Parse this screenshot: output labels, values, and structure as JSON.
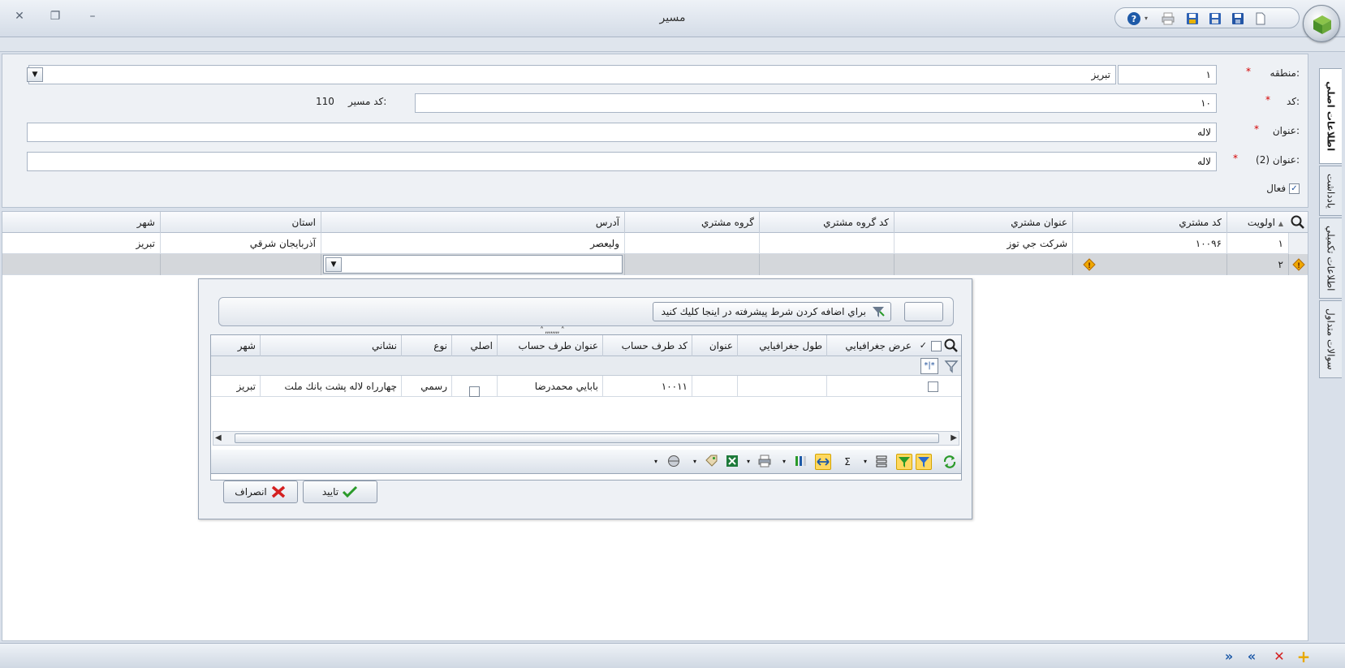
{
  "window": {
    "title": "مسير",
    "close_glyph": "✕",
    "restore_glyph": "❐",
    "minimize_glyph": "–"
  },
  "form": {
    "region_label": "منطقه:",
    "region_code": "١",
    "region_name": "تبريز",
    "code_label": "كد:",
    "code_value": "١٠",
    "route_code_label": "كد مسير:",
    "route_code_value": "110",
    "title_label": "عنوان:",
    "title_value": "لاله",
    "title2_label": "عنوان (2):",
    "title2_value": "لاله",
    "active_label": "فعال",
    "active_checked": "✓",
    "required_mark": "*"
  },
  "side_tabs": [
    {
      "label": "اطلاعات اصلي"
    },
    {
      "label": "يادداشت"
    },
    {
      "label": "اطلاعات تكميلي"
    },
    {
      "label": "سوالات متداول"
    }
  ],
  "grid": {
    "columns": [
      "اولويت",
      "كد مشتري",
      "عنوان مشتري",
      "كد گروه مشتري",
      "گروه مشتري",
      "آدرس",
      "استان",
      "شهر"
    ],
    "sort_indicator": "▲",
    "rows": [
      {
        "priority": "١",
        "customer_code": "١٠٠٩۶",
        "customer_title": "شركت جي توز",
        "group_code": "",
        "group": "",
        "address": "وليعصر",
        "province": "آذربايجان شرقي",
        "city": "تبريز"
      },
      {
        "priority": "٢",
        "customer_code": "",
        "customer_title": "",
        "group_code": "",
        "group": "",
        "address": "",
        "province": "",
        "city": ""
      }
    ]
  },
  "popup": {
    "filter_button": "براي اضافه كردن شرط پيشرفته در اينجا كليك كنيد",
    "drag_hint": "˄ ,,,,,,,, ˄",
    "columns": [
      "عرض جغرافيايي",
      "طول جغرافيايي",
      "عنوان",
      "كد طرف حساب",
      "عنوان طرف حساب",
      "اصلي",
      "نوع",
      "نشاني",
      "شهر"
    ],
    "check_header": "✓",
    "rows": [
      {
        "lat": "",
        "lng": "",
        "title": "",
        "account_code": "١٠٠١١",
        "account_title": "بابايي محمدرضا",
        "primary": "",
        "type": "رسمي",
        "address": "چهارراه لاله پشت بانك ملت",
        "city": "تبريز"
      }
    ],
    "ok_button": "تاييد",
    "cancel_button": "انصراف"
  },
  "colors": {
    "accent": "#1e5aa8",
    "required": "#d40000",
    "selected_row": "#d4d7db",
    "warning": "#f0a800"
  }
}
